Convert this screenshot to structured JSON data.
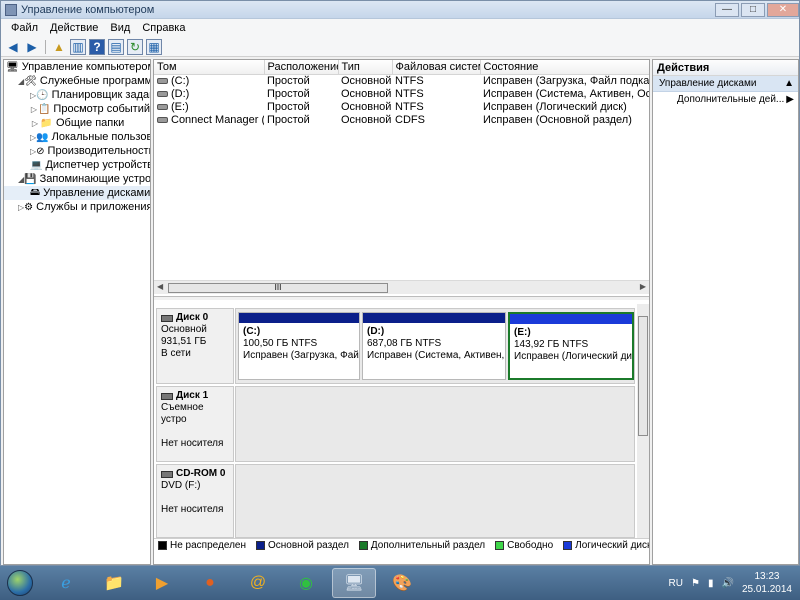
{
  "window": {
    "title": "Управление компьютером",
    "min": "—",
    "max": "□",
    "close": "✕"
  },
  "menu": [
    "Файл",
    "Действие",
    "Вид",
    "Справка"
  ],
  "toolbar_icons": [
    "back-icon",
    "forward-icon",
    "up-folder-icon",
    "show-hide-tree-icon",
    "help-icon",
    "properties-icon",
    "refresh-icon",
    "export-icon"
  ],
  "tree": [
    {
      "label": "Управление компьютером (л",
      "level": 0,
      "exp": "",
      "icon": "🖥"
    },
    {
      "label": "Служебные программы",
      "level": 1,
      "exp": "◢",
      "icon": "🛠"
    },
    {
      "label": "Планировщик заданий",
      "level": 2,
      "exp": "▷",
      "icon": "🕒"
    },
    {
      "label": "Просмотр событий",
      "level": 2,
      "exp": "▷",
      "icon": "📋"
    },
    {
      "label": "Общие папки",
      "level": 2,
      "exp": "▷",
      "icon": "📁"
    },
    {
      "label": "Локальные пользовате",
      "level": 2,
      "exp": "▷",
      "icon": "👥"
    },
    {
      "label": "Производительность",
      "level": 2,
      "exp": "▷",
      "icon": "⊘"
    },
    {
      "label": "Диспетчер устройств",
      "level": 2,
      "exp": "",
      "icon": "💻"
    },
    {
      "label": "Запоминающие устройст",
      "level": 1,
      "exp": "◢",
      "icon": "💾"
    },
    {
      "label": "Управление дисками",
      "level": 2,
      "exp": "",
      "icon": "🖴",
      "selected": true
    },
    {
      "label": "Службы и приложения",
      "level": 1,
      "exp": "▷",
      "icon": "⚙"
    }
  ],
  "volumes": {
    "headers": [
      "Том",
      "Расположение",
      "Тип",
      "Файловая система",
      "Состояние"
    ],
    "rows": [
      [
        "(C:)",
        "Простой",
        "Основной",
        "NTFS",
        "Исправен (Загрузка, Файл подкачки, А"
      ],
      [
        "(D:)",
        "Простой",
        "Основной",
        "NTFS",
        "Исправен (Система, Активен, Основно"
      ],
      [
        "(E:)",
        "Простой",
        "Основной",
        "NTFS",
        "Исправен (Логический диск)"
      ],
      [
        "Connect Manager (G:)",
        "Простой",
        "Основной",
        "CDFS",
        "Исправен (Основной раздел)"
      ]
    ]
  },
  "hscroll_grip": "III",
  "disks": [
    {
      "name": "Диск 0",
      "line1": "Основной",
      "line2": "931,51 ГБ",
      "line3": "В сети",
      "partitions": [
        {
          "label": "(C:)",
          "size": "100,50 ГБ NTFS",
          "status": "Исправен (Загрузка, Файл"
        },
        {
          "label": "(D:)",
          "size": "687,08 ГБ NTFS",
          "status": "Исправен (Система, Активен, О"
        },
        {
          "label": "(E:)",
          "size": "143,92 ГБ NTFS",
          "status": "Исправен (Логический ди"
        }
      ]
    },
    {
      "name": "Диск 1",
      "line1": "Съемное устро",
      "line2": "",
      "line3": "Нет носителя"
    },
    {
      "name": "CD-ROM 0",
      "line1": "DVD (F:)",
      "line2": "",
      "line3": "Нет носителя"
    }
  ],
  "legend": [
    {
      "label": "Не распределен",
      "color": "#000000"
    },
    {
      "label": "Основной раздел",
      "color": "#0a1f8a"
    },
    {
      "label": "Дополнительный раздел",
      "color": "#1b7a2a"
    },
    {
      "label": "Свободно",
      "color": "#3fd64a"
    },
    {
      "label": "Логический диск",
      "color": "#1a3ad9"
    }
  ],
  "actions": {
    "header": "Действия",
    "section": "Управление дисками",
    "more": "Дополнительные дей..."
  },
  "taskbar": {
    "apps": [
      "ie-icon",
      "explorer-icon",
      "media-player-icon",
      "firefox-icon",
      "mail-icon",
      "network-icon",
      "computer-management-icon",
      "paint-icon"
    ],
    "lang": "RU",
    "time": "13:23",
    "date": "25.01.2014"
  }
}
